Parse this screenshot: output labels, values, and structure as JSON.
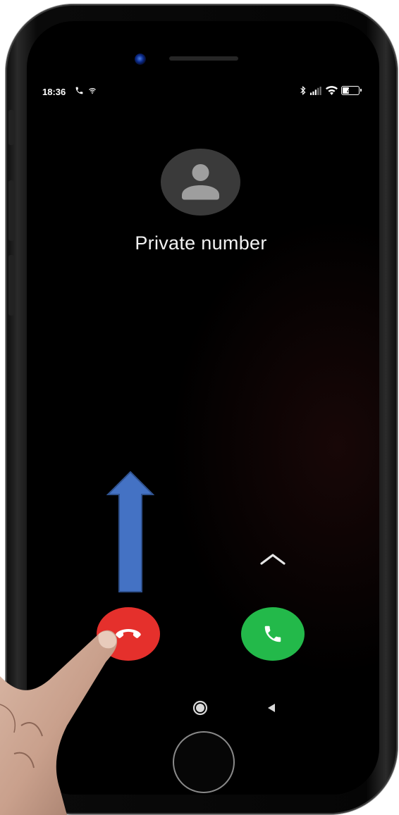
{
  "status_bar": {
    "time": "18:36",
    "left_icons": [
      "phone-call-icon",
      "wifi-calling-icon"
    ],
    "right_icons": [
      "bluetooth-icon",
      "signal-icon",
      "wifi-icon",
      "battery-icon"
    ],
    "battery_level": "46"
  },
  "caller": {
    "avatar_icon": "person-icon",
    "name": "Private number"
  },
  "controls": {
    "swipe_indicator_icon": "chevron-up-icon",
    "decline_icon": "phone-hangup-icon",
    "accept_icon": "phone-icon"
  },
  "annotation": {
    "arrow_icon": "up-arrow-icon",
    "arrow_color": "#4472c4"
  },
  "navigation": {
    "home_icon": "home-circle-icon",
    "back_icon": "back-triangle-icon"
  },
  "colors": {
    "decline": "#e5302c",
    "accept": "#23b94a",
    "screen_background": "#000000"
  }
}
